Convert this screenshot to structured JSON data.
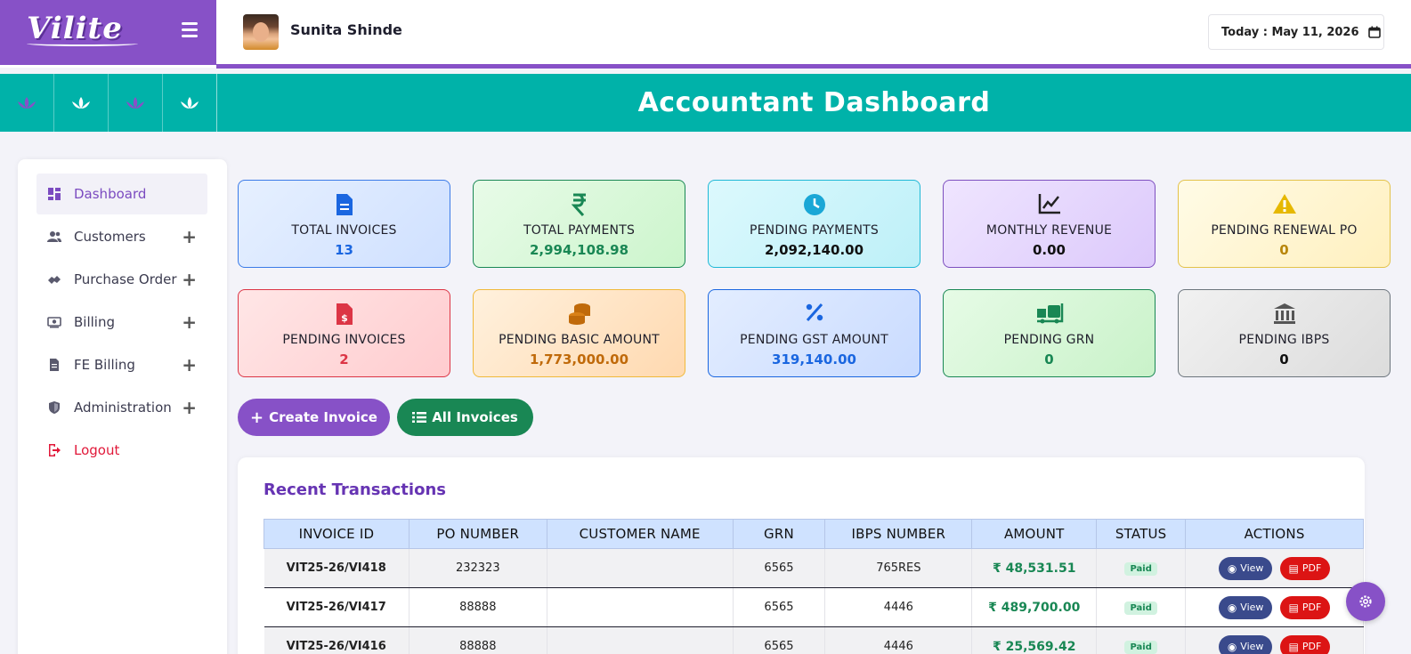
{
  "brand": {
    "logo_text": "Vilite"
  },
  "user": {
    "name": "Sunita Shinde"
  },
  "date": {
    "label": "Today : May 11, 2026"
  },
  "banner": {
    "title": "Accountant Dashboard"
  },
  "sidebar": {
    "items": [
      {
        "label": "Dashboard",
        "icon": "dashboard-icon",
        "active": true
      },
      {
        "label": "Customers",
        "icon": "users-icon",
        "expandable": true
      },
      {
        "label": "Purchase Order",
        "icon": "handshake-icon",
        "expandable": true
      },
      {
        "label": "Billing",
        "icon": "money-icon",
        "expandable": true
      },
      {
        "label": "FE Billing",
        "icon": "document-icon",
        "expandable": true
      },
      {
        "label": "Administration",
        "icon": "shield-icon",
        "expandable": true
      },
      {
        "label": "Logout",
        "icon": "logout-icon"
      }
    ],
    "plus_symbol": "+"
  },
  "stats": [
    {
      "label": "TOTAL INVOICES",
      "value": "13",
      "icon": "invoice-icon",
      "color": "#1a66e0"
    },
    {
      "label": "TOTAL PAYMENTS",
      "value": "2,994,108.98",
      "icon": "rupee-icon",
      "color": "#198754"
    },
    {
      "label": "PENDING PAYMENTS",
      "value": "2,092,140.00",
      "icon": "clock-icon",
      "color": "#111111"
    },
    {
      "label": "MONTHLY REVENUE",
      "value": "0.00",
      "icon": "line-chart-icon",
      "color": "#111111"
    },
    {
      "label": "PENDING RENEWAL PO",
      "value": "0",
      "icon": "warning-icon",
      "color": "#b8860b"
    },
    {
      "label": "PENDING INVOICES",
      "value": "2",
      "icon": "dollar-file-icon",
      "color": "#dc3545"
    },
    {
      "label": "PENDING BASIC AMOUNT",
      "value": "1,773,000.00",
      "icon": "coins-icon",
      "color": "#c06a0a"
    },
    {
      "label": "PENDING GST AMOUNT",
      "value": "319,140.00",
      "icon": "percent-icon",
      "color": "#1a66e0"
    },
    {
      "label": "PENDING GRN",
      "value": "0",
      "icon": "dolly-icon",
      "color": "#198754"
    },
    {
      "label": "PENDING IBPS",
      "value": "0",
      "icon": "bank-icon",
      "color": "#111111"
    }
  ],
  "actions": {
    "create_label": "Create Invoice",
    "all_label": "All Invoices"
  },
  "transactions": {
    "title": "Recent Transactions",
    "columns": [
      "INVOICE ID",
      "PO NUMBER",
      "CUSTOMER NAME",
      "GRN",
      "IBPS NUMBER",
      "AMOUNT",
      "STATUS",
      "ACTIONS"
    ],
    "rows": [
      {
        "invoice_id": "VIT25-26/VI418",
        "po_number": "232323",
        "customer": "",
        "grn": "6565",
        "ibps": "765RES",
        "amount": "₹ 48,531.51",
        "status": "Paid"
      },
      {
        "invoice_id": "VIT25-26/VI417",
        "po_number": "88888",
        "customer": "",
        "grn": "6565",
        "ibps": "4446",
        "amount": "₹ 489,700.00",
        "status": "Paid"
      },
      {
        "invoice_id": "VIT25-26/VI416",
        "po_number": "88888",
        "customer": "",
        "grn": "6565",
        "ibps": "4446",
        "amount": "₹ 25,569.42",
        "status": "Paid"
      }
    ],
    "view_label": "View",
    "pdf_label": "PDF"
  }
}
